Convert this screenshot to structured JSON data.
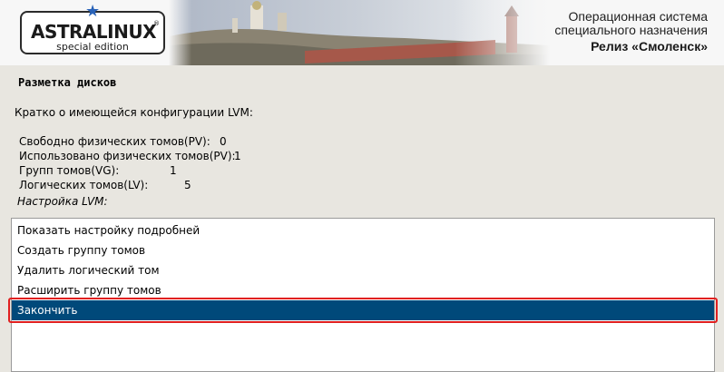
{
  "banner": {
    "logo_title": "ASTRALINUX",
    "logo_registered": "®",
    "logo_subtitle": "special edition",
    "os_line1": "Операционная система",
    "os_line2": "специального назначения",
    "release": "Релиз «Смоленск»"
  },
  "panel": {
    "title": "Разметка дисков",
    "intro": "Кратко о имеющейся конфигурации LVM:",
    "stats": [
      {
        "label": "Свободно физических томов(PV):",
        "value": "0"
      },
      {
        "label": "Использовано физических томов(PV):",
        "value": "1"
      },
      {
        "label": "Групп томов(VG):",
        "value": "1"
      },
      {
        "label": "Логических томов(LV):",
        "value": "5"
      }
    ],
    "lvm_label": "Настройка LVM:"
  },
  "menu": {
    "items": [
      {
        "label": "Показать настройку подробней"
      },
      {
        "label": "Создать группу томов"
      },
      {
        "label": "Удалить логический том"
      },
      {
        "label": "Расширить группу томов"
      },
      {
        "label": "Закончить"
      }
    ],
    "selected_index": 4
  },
  "colors": {
    "selection_bg": "#00497a",
    "highlight_outline": "#e02020",
    "page_bg": "#e8e6e0"
  }
}
